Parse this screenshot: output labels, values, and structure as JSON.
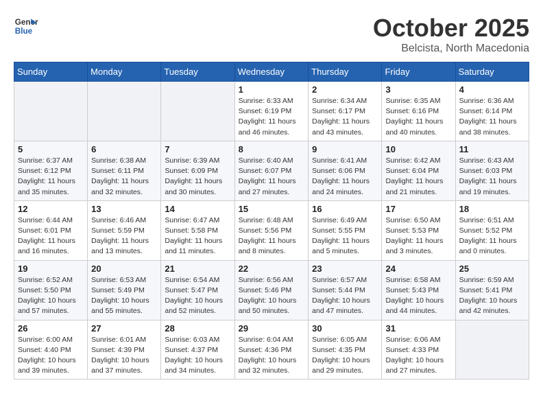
{
  "header": {
    "logo_general": "General",
    "logo_blue": "Blue",
    "month": "October 2025",
    "location": "Belcista, North Macedonia"
  },
  "days_of_week": [
    "Sunday",
    "Monday",
    "Tuesday",
    "Wednesday",
    "Thursday",
    "Friday",
    "Saturday"
  ],
  "weeks": [
    [
      {
        "day": "",
        "info": ""
      },
      {
        "day": "",
        "info": ""
      },
      {
        "day": "",
        "info": ""
      },
      {
        "day": "1",
        "info": "Sunrise: 6:33 AM\nSunset: 6:19 PM\nDaylight: 11 hours\nand 46 minutes."
      },
      {
        "day": "2",
        "info": "Sunrise: 6:34 AM\nSunset: 6:17 PM\nDaylight: 11 hours\nand 43 minutes."
      },
      {
        "day": "3",
        "info": "Sunrise: 6:35 AM\nSunset: 6:16 PM\nDaylight: 11 hours\nand 40 minutes."
      },
      {
        "day": "4",
        "info": "Sunrise: 6:36 AM\nSunset: 6:14 PM\nDaylight: 11 hours\nand 38 minutes."
      }
    ],
    [
      {
        "day": "5",
        "info": "Sunrise: 6:37 AM\nSunset: 6:12 PM\nDaylight: 11 hours\nand 35 minutes."
      },
      {
        "day": "6",
        "info": "Sunrise: 6:38 AM\nSunset: 6:11 PM\nDaylight: 11 hours\nand 32 minutes."
      },
      {
        "day": "7",
        "info": "Sunrise: 6:39 AM\nSunset: 6:09 PM\nDaylight: 11 hours\nand 30 minutes."
      },
      {
        "day": "8",
        "info": "Sunrise: 6:40 AM\nSunset: 6:07 PM\nDaylight: 11 hours\nand 27 minutes."
      },
      {
        "day": "9",
        "info": "Sunrise: 6:41 AM\nSunset: 6:06 PM\nDaylight: 11 hours\nand 24 minutes."
      },
      {
        "day": "10",
        "info": "Sunrise: 6:42 AM\nSunset: 6:04 PM\nDaylight: 11 hours\nand 21 minutes."
      },
      {
        "day": "11",
        "info": "Sunrise: 6:43 AM\nSunset: 6:03 PM\nDaylight: 11 hours\nand 19 minutes."
      }
    ],
    [
      {
        "day": "12",
        "info": "Sunrise: 6:44 AM\nSunset: 6:01 PM\nDaylight: 11 hours\nand 16 minutes."
      },
      {
        "day": "13",
        "info": "Sunrise: 6:46 AM\nSunset: 5:59 PM\nDaylight: 11 hours\nand 13 minutes."
      },
      {
        "day": "14",
        "info": "Sunrise: 6:47 AM\nSunset: 5:58 PM\nDaylight: 11 hours\nand 11 minutes."
      },
      {
        "day": "15",
        "info": "Sunrise: 6:48 AM\nSunset: 5:56 PM\nDaylight: 11 hours\nand 8 minutes."
      },
      {
        "day": "16",
        "info": "Sunrise: 6:49 AM\nSunset: 5:55 PM\nDaylight: 11 hours\nand 5 minutes."
      },
      {
        "day": "17",
        "info": "Sunrise: 6:50 AM\nSunset: 5:53 PM\nDaylight: 11 hours\nand 3 minutes."
      },
      {
        "day": "18",
        "info": "Sunrise: 6:51 AM\nSunset: 5:52 PM\nDaylight: 11 hours\nand 0 minutes."
      }
    ],
    [
      {
        "day": "19",
        "info": "Sunrise: 6:52 AM\nSunset: 5:50 PM\nDaylight: 10 hours\nand 57 minutes."
      },
      {
        "day": "20",
        "info": "Sunrise: 6:53 AM\nSunset: 5:49 PM\nDaylight: 10 hours\nand 55 minutes."
      },
      {
        "day": "21",
        "info": "Sunrise: 6:54 AM\nSunset: 5:47 PM\nDaylight: 10 hours\nand 52 minutes."
      },
      {
        "day": "22",
        "info": "Sunrise: 6:56 AM\nSunset: 5:46 PM\nDaylight: 10 hours\nand 50 minutes."
      },
      {
        "day": "23",
        "info": "Sunrise: 6:57 AM\nSunset: 5:44 PM\nDaylight: 10 hours\nand 47 minutes."
      },
      {
        "day": "24",
        "info": "Sunrise: 6:58 AM\nSunset: 5:43 PM\nDaylight: 10 hours\nand 44 minutes."
      },
      {
        "day": "25",
        "info": "Sunrise: 6:59 AM\nSunset: 5:41 PM\nDaylight: 10 hours\nand 42 minutes."
      }
    ],
    [
      {
        "day": "26",
        "info": "Sunrise: 6:00 AM\nSunset: 4:40 PM\nDaylight: 10 hours\nand 39 minutes."
      },
      {
        "day": "27",
        "info": "Sunrise: 6:01 AM\nSunset: 4:39 PM\nDaylight: 10 hours\nand 37 minutes."
      },
      {
        "day": "28",
        "info": "Sunrise: 6:03 AM\nSunset: 4:37 PM\nDaylight: 10 hours\nand 34 minutes."
      },
      {
        "day": "29",
        "info": "Sunrise: 6:04 AM\nSunset: 4:36 PM\nDaylight: 10 hours\nand 32 minutes."
      },
      {
        "day": "30",
        "info": "Sunrise: 6:05 AM\nSunset: 4:35 PM\nDaylight: 10 hours\nand 29 minutes."
      },
      {
        "day": "31",
        "info": "Sunrise: 6:06 AM\nSunset: 4:33 PM\nDaylight: 10 hours\nand 27 minutes."
      },
      {
        "day": "",
        "info": ""
      }
    ]
  ]
}
